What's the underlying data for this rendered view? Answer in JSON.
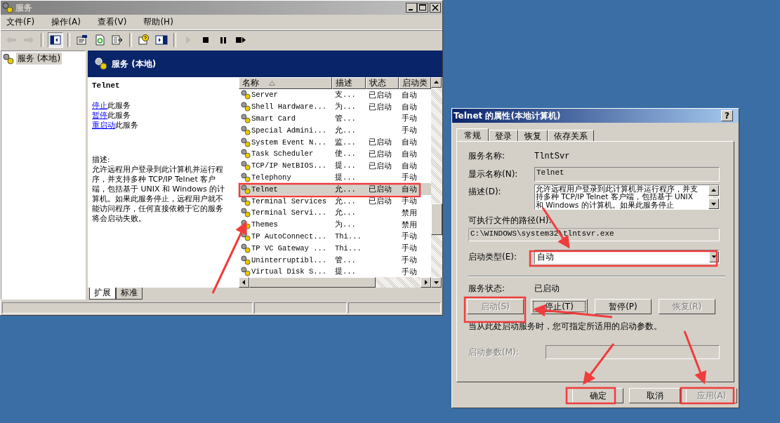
{
  "main_window": {
    "title": "服务",
    "menu": [
      "文件(F)",
      "操作(A)",
      "查看(V)",
      "帮助(H)"
    ],
    "toolbar": [
      {
        "kind": "back",
        "disabled": true,
        "pressed": false
      },
      {
        "kind": "forward",
        "disabled": true,
        "pressed": false
      },
      {
        "kind": "tree",
        "disabled": false,
        "pressed": true
      },
      {
        "kind": "properties",
        "disabled": false,
        "pressed": false
      },
      {
        "kind": "refresh",
        "disabled": false,
        "pressed": false
      },
      {
        "kind": "export",
        "disabled": false,
        "pressed": false
      },
      {
        "kind": "help",
        "disabled": false,
        "pressed": false
      },
      {
        "kind": "pane",
        "disabled": false,
        "pressed": false
      },
      {
        "kind": "play",
        "disabled": true,
        "pressed": false
      },
      {
        "kind": "stop",
        "disabled": false,
        "pressed": false
      },
      {
        "kind": "pause",
        "disabled": false,
        "pressed": false
      },
      {
        "kind": "restart",
        "disabled": false,
        "pressed": false
      }
    ],
    "tree": [
      {
        "label": "服务 (本地)",
        "selected": true
      }
    ],
    "header": "服务 (本地)",
    "detail": {
      "title": "Telnet",
      "actions": [
        {
          "link": "停止",
          "text": "此服务"
        },
        {
          "link": "暂停",
          "text": "此服务"
        },
        {
          "link": "重启动",
          "text": "此服务"
        }
      ],
      "description_label": "描述:",
      "description": "允许远程用户登录到此计算机并运行程序，并支持多种 TCP/IP Telnet 客户端，包括基于 UNIX 和 Windows 的计算机。如果此服务停止，远程用户就不能访问程序，任何直接依赖于它的服务将会启动失败。"
    },
    "columns": [
      {
        "label": "名称",
        "sorted": true
      },
      {
        "label": "描述",
        "sorted": false
      },
      {
        "label": "状态",
        "sorted": false
      },
      {
        "label": "启动类",
        "sorted": false
      }
    ],
    "rows": [
      {
        "name": "Server",
        "description": "支...",
        "status": "已启动",
        "startup": "自动",
        "selected": false
      },
      {
        "name": "Shell Hardware...",
        "description": "为...",
        "status": "已启动",
        "startup": "自动",
        "selected": false
      },
      {
        "name": "Smart Card",
        "description": "管...",
        "status": "",
        "startup": "手动",
        "selected": false
      },
      {
        "name": "Special Admini...",
        "description": "允...",
        "status": "",
        "startup": "手动",
        "selected": false
      },
      {
        "name": "System Event N...",
        "description": "监...",
        "status": "已启动",
        "startup": "自动",
        "selected": false
      },
      {
        "name": "Task Scheduler",
        "description": "使...",
        "status": "已启动",
        "startup": "自动",
        "selected": false
      },
      {
        "name": "TCP/IP NetBIOS...",
        "description": "提...",
        "status": "已启动",
        "startup": "自动",
        "selected": false
      },
      {
        "name": "Telephony",
        "description": "提...",
        "status": "",
        "startup": "手动",
        "selected": false
      },
      {
        "name": "Telnet",
        "description": "允...",
        "status": "已启动",
        "startup": "自动",
        "selected": true
      },
      {
        "name": "Terminal Services",
        "description": "允...",
        "status": "已启动",
        "startup": "手动",
        "selected": false
      },
      {
        "name": "Terminal Servi...",
        "description": "允...",
        "status": "",
        "startup": "禁用",
        "selected": false
      },
      {
        "name": "Themes",
        "description": "为...",
        "status": "",
        "startup": "禁用",
        "selected": false
      },
      {
        "name": "TP AutoConnect...",
        "description": "Thi...",
        "status": "",
        "startup": "手动",
        "selected": false
      },
      {
        "name": "TP VC Gateway ...",
        "description": "Thi...",
        "status": "",
        "startup": "手动",
        "selected": false
      },
      {
        "name": "Uninterruptibl...",
        "description": "管...",
        "status": "",
        "startup": "手动",
        "selected": false
      },
      {
        "name": "Virtual Disk S...",
        "description": "提...",
        "status": "",
        "startup": "手动",
        "selected": false
      }
    ],
    "view_tabs": [
      {
        "label": "扩展",
        "selected": true
      },
      {
        "label": "标准",
        "selected": false
      }
    ]
  },
  "dialog": {
    "title": "Telnet 的属性(本地计算机)",
    "help": "?",
    "tabs": [
      {
        "label": "常规",
        "selected": true
      },
      {
        "label": "登录",
        "selected": false
      },
      {
        "label": "恢复",
        "selected": false
      },
      {
        "label": "依存关系",
        "selected": false
      }
    ],
    "service_name_label": "服务名称:",
    "service_name": "TlntSvr",
    "display_name_label": "显示名称(N):",
    "display_name": "Telnet",
    "description_label": "描述(D):",
    "description": "允许远程用户登录到此计算机并运行程序，并支持多种 TCP/IP Telnet 客户端，包括基于 UNIX 和 Windows 的计算机。如果此服务停止",
    "path_label": "可执行文件的路径(H):",
    "path": "C:\\WINDOWS\\system32\\tlntsvr.exe",
    "startup_type_label": "启动类型(E):",
    "startup_type": "自动",
    "status_label": "服务状态:",
    "status": "已启动",
    "service_buttons": [
      {
        "label": "启动(S)",
        "disabled": true,
        "focused": false
      },
      {
        "label": "停止(T)",
        "disabled": false,
        "focused": true
      },
      {
        "label": "暂停(P)",
        "disabled": false,
        "focused": false
      },
      {
        "label": "恢复(R)",
        "disabled": true,
        "focused": false
      }
    ],
    "hint": "当从此处启动服务时，您可指定所适用的启动参数。",
    "params_label": "启动参数(M):",
    "params_disabled": true,
    "buttons": [
      {
        "label": "确定",
        "disabled": false
      },
      {
        "label": "取消",
        "disabled": false
      },
      {
        "label": "应用(A)",
        "disabled": true
      }
    ]
  }
}
